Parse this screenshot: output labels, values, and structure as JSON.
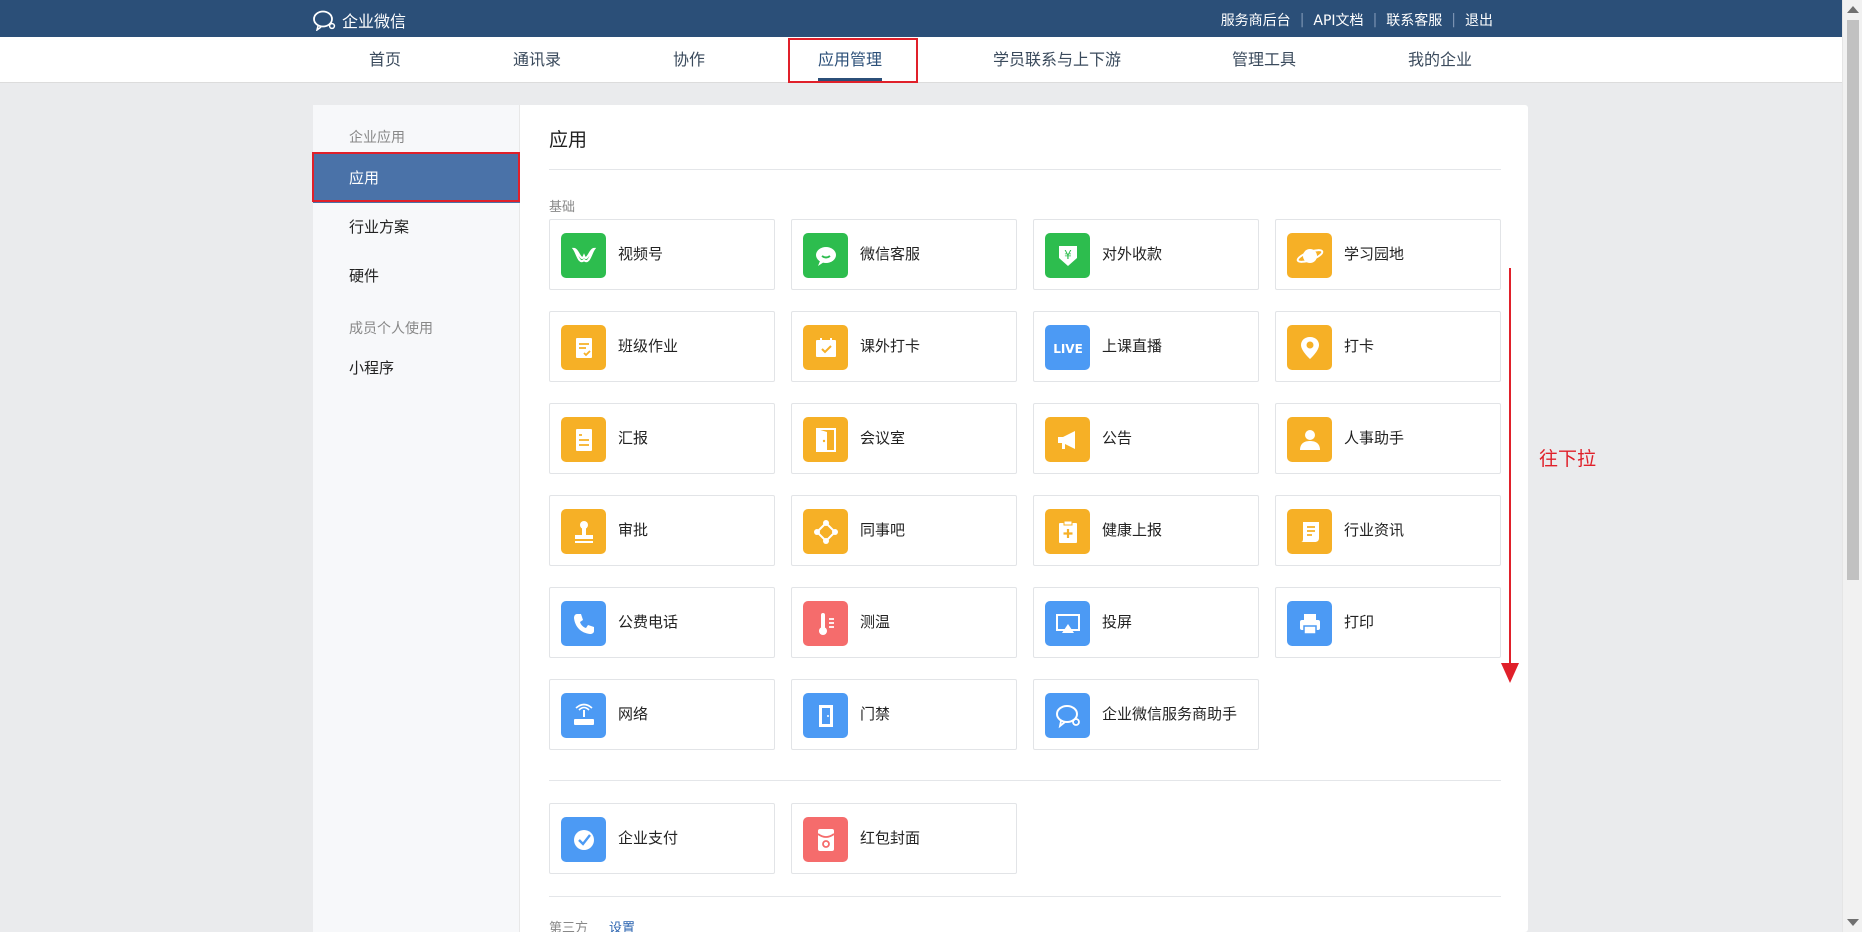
{
  "topbar": {
    "brand": "企业微信",
    "links": [
      "服务商后台",
      "API文档",
      "联系客服",
      "退出"
    ]
  },
  "nav": {
    "items": [
      "首页",
      "通讯录",
      "协作",
      "应用管理",
      "学员联系与上下游",
      "管理工具",
      "我的企业"
    ],
    "active": "应用管理"
  },
  "sidebar": {
    "group1": "企业应用",
    "items1": [
      "应用",
      "行业方案",
      "硬件"
    ],
    "group2": "成员个人使用",
    "items2": [
      "小程序"
    ],
    "active": "应用"
  },
  "content": {
    "title": "应用",
    "section_basic": "基础",
    "apps": [
      {
        "label": "视频号",
        "icon": "video-channel-icon",
        "color": "#2dbd4e"
      },
      {
        "label": "微信客服",
        "icon": "chat-bubble-icon",
        "color": "#2dbd4e"
      },
      {
        "label": "对外收款",
        "icon": "yuan-shield-icon",
        "color": "#2dbd4e"
      },
      {
        "label": "学习园地",
        "icon": "planet-icon",
        "color": "#f6b026"
      },
      {
        "label": "班级作业",
        "icon": "homework-icon",
        "color": "#f6b026"
      },
      {
        "label": "课外打卡",
        "icon": "calendar-check-icon",
        "color": "#f6b026"
      },
      {
        "label": "上课直播",
        "icon": "live-icon",
        "color": "#4c9af4"
      },
      {
        "label": "打卡",
        "icon": "location-pin-icon",
        "color": "#f6b026"
      },
      {
        "label": "汇报",
        "icon": "report-icon",
        "color": "#f6b026"
      },
      {
        "label": "会议室",
        "icon": "door-icon",
        "color": "#f6b026"
      },
      {
        "label": "公告",
        "icon": "megaphone-icon",
        "color": "#f6b026"
      },
      {
        "label": "人事助手",
        "icon": "person-icon",
        "color": "#f6b026"
      },
      {
        "label": "审批",
        "icon": "stamp-icon",
        "color": "#f6b026"
      },
      {
        "label": "同事吧",
        "icon": "network-nodes-icon",
        "color": "#f6b026"
      },
      {
        "label": "健康上报",
        "icon": "clipboard-plus-icon",
        "color": "#f6b026"
      },
      {
        "label": "行业资讯",
        "icon": "news-icon",
        "color": "#f6b026"
      },
      {
        "label": "公费电话",
        "icon": "phone-icon",
        "color": "#4c9af4"
      },
      {
        "label": "测温",
        "icon": "thermometer-icon",
        "color": "#f56c6c"
      },
      {
        "label": "投屏",
        "icon": "screen-cast-icon",
        "color": "#4c9af4"
      },
      {
        "label": "打印",
        "icon": "printer-icon",
        "color": "#4c9af4"
      },
      {
        "label": "网络",
        "icon": "router-icon",
        "color": "#4c9af4"
      },
      {
        "label": "门禁",
        "icon": "access-door-icon",
        "color": "#4c9af4"
      },
      {
        "label": "企业微信服务商助手",
        "icon": "wework-logo-icon",
        "color": "#4c9af4"
      }
    ],
    "apps2": [
      {
        "label": "企业支付",
        "icon": "pay-check-icon",
        "color": "#4c9af4"
      },
      {
        "label": "红包封面",
        "icon": "red-packet-icon",
        "color": "#f56c6c"
      }
    ],
    "section_third": "第三方",
    "third_link": "设置"
  },
  "annotation": {
    "text": "往下拉",
    "color": "#e0202a"
  }
}
